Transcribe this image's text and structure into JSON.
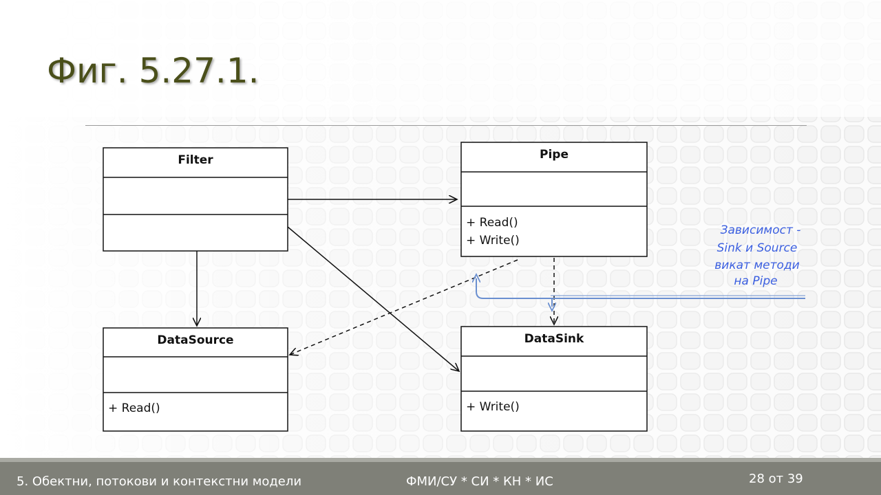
{
  "slide": {
    "title": "Фиг. 5.27.1."
  },
  "diagram": {
    "classes": {
      "filter": {
        "name": "Filter",
        "ops": []
      },
      "pipe": {
        "name": "Pipe",
        "ops": [
          "+ Read()",
          "+ Write()"
        ]
      },
      "data_source": {
        "name": "DataSource",
        "ops": [
          "+ Read()"
        ]
      },
      "data_sink": {
        "name": "DataSink",
        "ops": [
          "+ Write()"
        ]
      }
    },
    "note": {
      "lines": [
        "Зависимост -",
        "Sink и Source",
        "викат методи",
        "на  Pipe"
      ],
      "color": "#3b5fe0"
    },
    "annotation_arrow_color": "#6a8fd0"
  },
  "footer": {
    "left": "5. Обектни, потокови и контекстни модели",
    "center": "ФМИ/СУ  *  СИ  * КН * ИС",
    "page": "28 от 39",
    "background": "#7f8078"
  }
}
